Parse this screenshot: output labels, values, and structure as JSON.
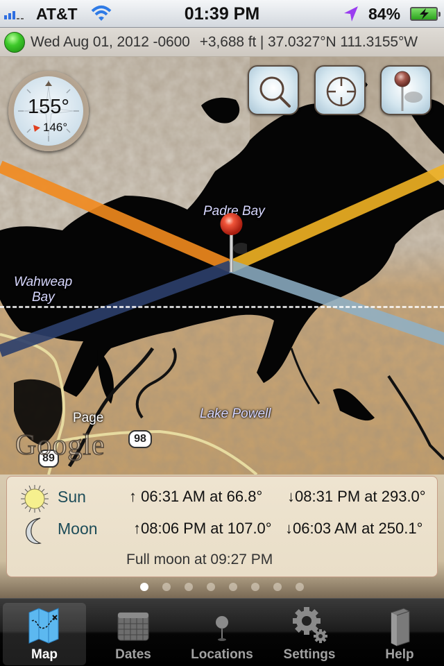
{
  "status_bar": {
    "carrier": "AT&T",
    "time": "01:39 PM",
    "battery_percent": "84%",
    "signal_bars": 3,
    "signal_bars_total": 5,
    "battery_charging": true
  },
  "info_bar": {
    "status": "gps-fix-ok",
    "status_color": "#3ec92a",
    "date": "Wed Aug 01, 2012 -0600",
    "elevation_coords": "+3,688 ft | 37.0327°N 111.3155°W"
  },
  "map": {
    "compass": {
      "heading": "155°",
      "secondary_heading": "146°"
    },
    "buttons": [
      {
        "name": "search",
        "icon": "magnifier-icon"
      },
      {
        "name": "locate",
        "icon": "crosshair-icon"
      },
      {
        "name": "drop-pin",
        "icon": "pin-icon"
      }
    ],
    "labels": {
      "padre_bay": "Padre Bay",
      "wahweap_bay_1": "Wahweap",
      "wahweap_bay_2": "Bay",
      "lake_powell": "Lake Powell",
      "page": "Page"
    },
    "road_shields": {
      "route_98": "98",
      "route_89": "89"
    },
    "attribution": "Google",
    "line_colors": {
      "sunrise": "#f28a1e",
      "sunset": "#f0b224",
      "moonrise": "#2c3f6c",
      "moonset": "#8fb1c7"
    }
  },
  "ephemeris": {
    "sun": {
      "name": "Sun",
      "rise": "↑ 06:31 AM at 66.8°",
      "set": "↓08:31 PM at 293.0°"
    },
    "moon": {
      "name": "Moon",
      "rise": "↑08:06 PM at 107.0°",
      "set": "↓06:03 AM at 250.1°"
    },
    "note": "Full moon at 09:27 PM"
  },
  "pager": {
    "total": 8,
    "active_index": 0
  },
  "tab_bar": {
    "tabs": [
      {
        "label": "Map",
        "active": true
      },
      {
        "label": "Dates",
        "active": false
      },
      {
        "label": "Locations",
        "active": false
      },
      {
        "label": "Settings",
        "active": false
      },
      {
        "label": "Help",
        "active": false
      }
    ]
  }
}
